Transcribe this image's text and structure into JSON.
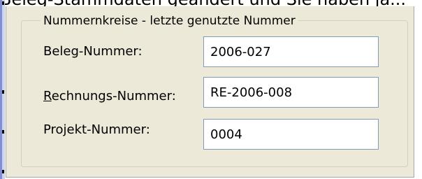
{
  "window": {
    "clipped_text": "Beleg-Stammdaten geändert und Sie haben ja..."
  },
  "groupbox": {
    "title": "Nummernkreise  - letzte genutzte Nummer"
  },
  "rows": [
    {
      "label": "Beleg-Nummer:",
      "value": "2006-027"
    },
    {
      "label": "Rechnungs-Nummer:",
      "value": "RE-2006-008",
      "accelerator": "R"
    },
    {
      "label": "Projekt-Nummer:",
      "value": "0004"
    }
  ]
}
